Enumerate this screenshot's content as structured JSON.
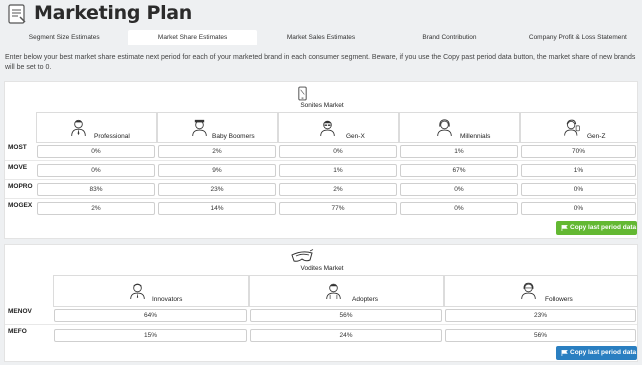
{
  "header": {
    "title": "Marketing Plan",
    "logo_icon": "notebook-icon"
  },
  "tabs": [
    {
      "label": "Segment Size Estimates",
      "active": false
    },
    {
      "label": "Market Share Estimates",
      "active": true
    },
    {
      "label": "Market Sales Estimates",
      "active": false
    },
    {
      "label": "Brand Contribution",
      "active": false
    },
    {
      "label": "Company Profit & Loss Statement",
      "active": false
    }
  ],
  "intro": "Enter below your best market share estimate next period for each of your marketed brand in each consumer segment. Beware, if you use the Copy past period data button, the market share of new brands will be set to 0.",
  "sonites": {
    "title": "Sonites Market",
    "icon": "phone-icon",
    "segments": [
      "Professional",
      "Baby Boomers",
      "Gen-X",
      "Millennials",
      "Gen-Z"
    ],
    "brands": [
      {
        "name": "MOST",
        "values": [
          "0%",
          "2%",
          "0%",
          "1%",
          "70%"
        ]
      },
      {
        "name": "MOVE",
        "values": [
          "0%",
          "9%",
          "1%",
          "67%",
          "1%"
        ]
      },
      {
        "name": "MOPRO",
        "values": [
          "83%",
          "23%",
          "2%",
          "0%",
          "0%"
        ]
      },
      {
        "name": "MOGEX",
        "values": [
          "2%",
          "14%",
          "77%",
          "0%",
          "0%"
        ]
      }
    ],
    "button": "Copy last period data",
    "button_color": "#63b832"
  },
  "vodites": {
    "title": "Vodites Market",
    "icon": "vr-headset-icon",
    "segments": [
      "Innovators",
      "Adopters",
      "Followers"
    ],
    "brands": [
      {
        "name": "MENOV",
        "values": [
          "64%",
          "56%",
          "23%"
        ]
      },
      {
        "name": "MEFO",
        "values": [
          "15%",
          "24%",
          "56%"
        ]
      }
    ],
    "button": "Copy last period data",
    "button_color": "#2a7fc1"
  }
}
